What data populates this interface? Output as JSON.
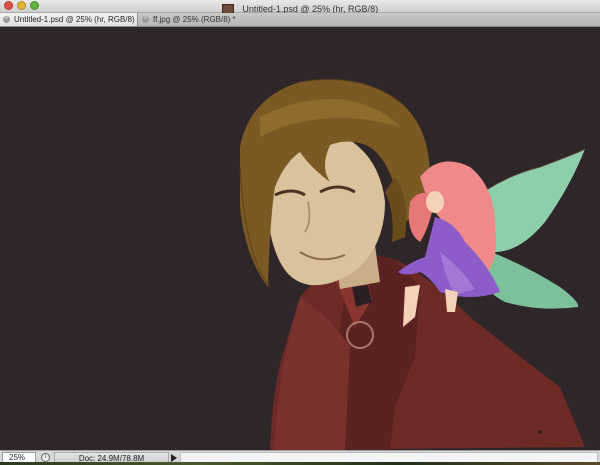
{
  "window": {
    "title": "Untitled-1.psd @ 25% (hr, RGB/8)"
  },
  "tabs": [
    {
      "label": "Untitled-1.psd @ 25% (hr, RGB/8)",
      "active": true
    },
    {
      "label": "ff.jpg @ 25% (RGB/8) *",
      "active": false
    }
  ],
  "statusbar": {
    "zoom": "25%",
    "doc_info": "Doc: 24.9M/78.8M"
  },
  "colors": {
    "canvas_background": "#2e2629",
    "hair": "#7a5a22",
    "skin": "#d9c29c",
    "cape": "#6e2a27",
    "fairy_hair": "#f08a8a",
    "fairy_dress": "#8d5cc9",
    "wings": "#8ccfa8"
  },
  "icons": {
    "tab_close": "close-icon",
    "status_info": "info-icon",
    "status_menu": "triangle-right-icon",
    "document": "psd-document-icon"
  }
}
